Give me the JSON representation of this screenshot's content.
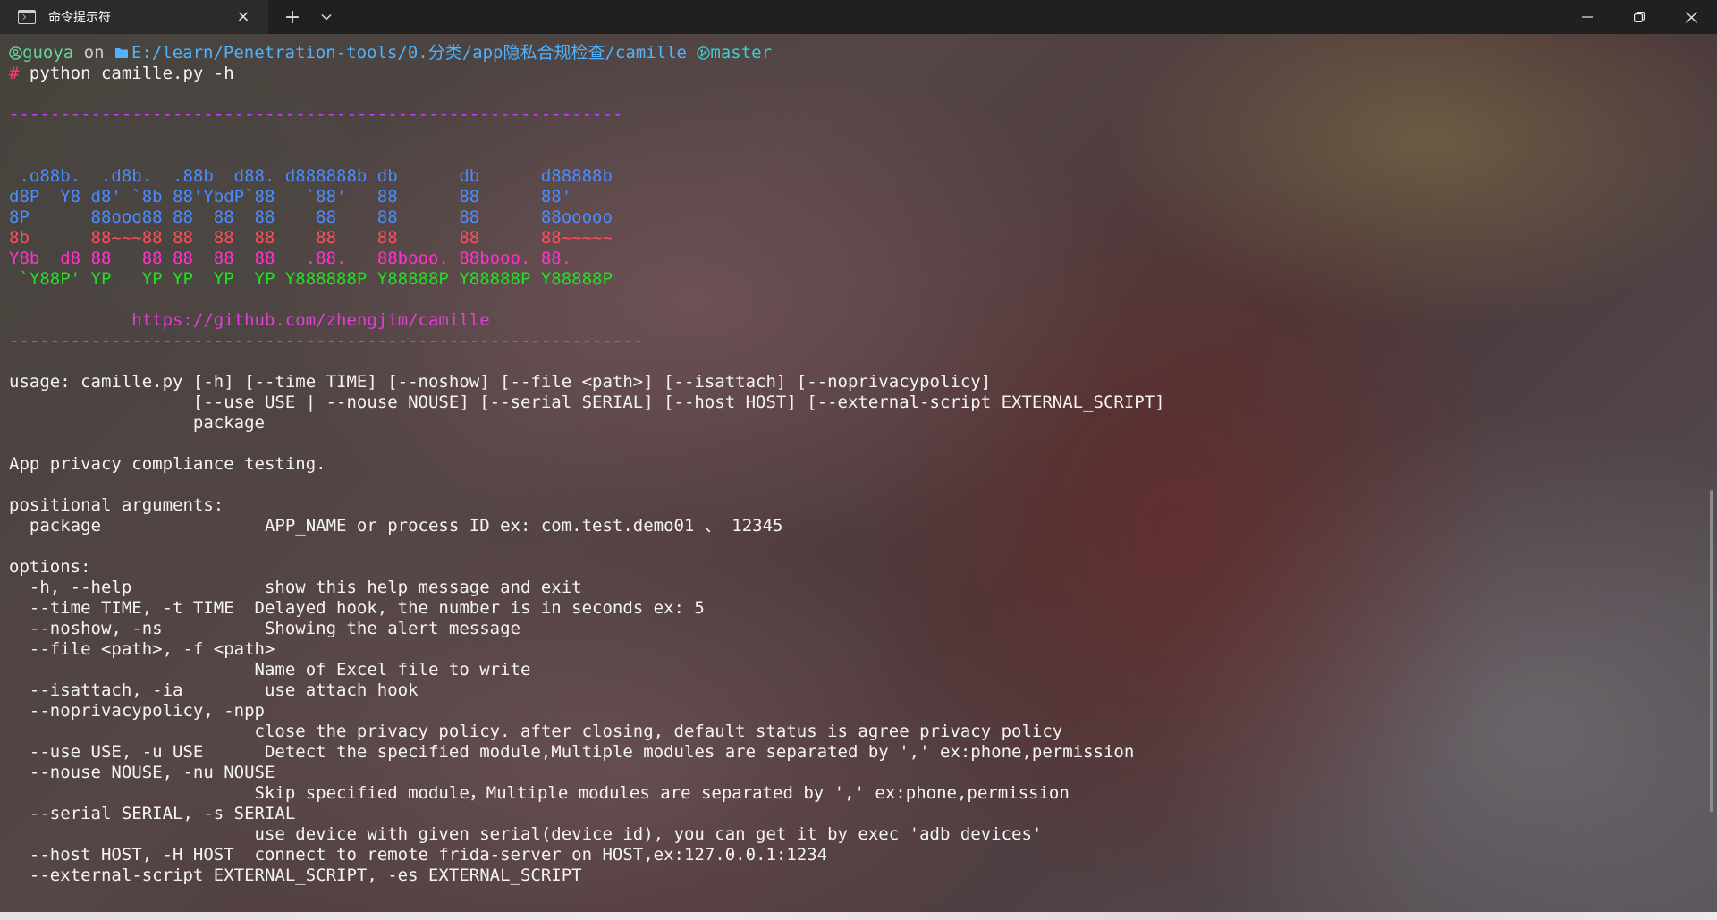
{
  "window": {
    "tab_title": "命令提示符",
    "tab_close": "×",
    "new_tab": "+"
  },
  "terminal": {
    "prompt": {
      "user": "guoya",
      "on": " on ",
      "path": "E:/learn/Penetration-tools/0.分类/app隐私合规检查/camille",
      "branch": "master",
      "hash": "#",
      "command": " python camille.py -h"
    },
    "banner": {
      "separator_top": "------------------------------------------------------------",
      "art": [
        {
          "text": " .o88b.  .d8b.  .88b  d88. d888888b db      db      d88888b",
          "color": "blue"
        },
        {
          "text": "d8P  Y8 d8' `8b 88'YbdP`88   `88'   88      88      88'",
          "color": "blue"
        },
        {
          "text": "8P      88ooo88 88  88  88    88    88      88      88ooooo",
          "color": "blue"
        },
        {
          "text": "8b      88~~~88 88  88  88    88    88      88      88~~~~~",
          "color": "red"
        },
        {
          "text": "Y8b  d8 88   88 88  88  88   .88.   88booo. 88booo. 88.",
          "color": "pink"
        },
        {
          "text": " `Y88P' YP   YP YP  YP  YP Y888888P Y88888P Y88888P Y88888P",
          "color": "green"
        }
      ],
      "link": "            https://github.com/zhengjim/camille",
      "separator_bottom": "--------------------------------------------------------------"
    },
    "help": [
      "usage: camille.py [-h] [--time TIME] [--noshow] [--file <path>] [--isattach] [--noprivacypolicy]",
      "                  [--use USE | --nouse NOUSE] [--serial SERIAL] [--host HOST] [--external-script EXTERNAL_SCRIPT]",
      "                  package",
      "",
      "App privacy compliance testing.",
      "",
      "positional arguments:",
      "  package                APP_NAME or process ID ex: com.test.demo01 、 12345",
      "",
      "options:",
      "  -h, --help             show this help message and exit",
      "  --time TIME, -t TIME  Delayed hook, the number is in seconds ex: 5",
      "  --noshow, -ns          Showing the alert message",
      "  --file <path>, -f <path>",
      "                        Name of Excel file to write",
      "  --isattach, -ia        use attach hook",
      "  --noprivacypolicy, -npp",
      "                        close the privacy policy. after closing, default status is agree privacy policy",
      "  --use USE, -u USE      Detect the specified module,Multiple modules are separated by ',' ex:phone,permission",
      "  --nouse NOUSE, -nu NOUSE",
      "                        Skip specified module，Multiple modules are separated by ',' ex:phone,permission",
      "  --serial SERIAL, -s SERIAL",
      "                        use device with given serial(device id), you can get it by exec 'adb devices'",
      "  --host HOST, -H HOST  connect to remote frida-server on HOST,ex:127.0.0.1:1234",
      "  --external-script EXTERNAL_SCRIPT, -es EXTERNAL_SCRIPT"
    ]
  },
  "colors": {
    "blue": "#4a8cff",
    "red": "#ff4d5a",
    "pink": "#ff33cc",
    "green": "#22e022"
  }
}
